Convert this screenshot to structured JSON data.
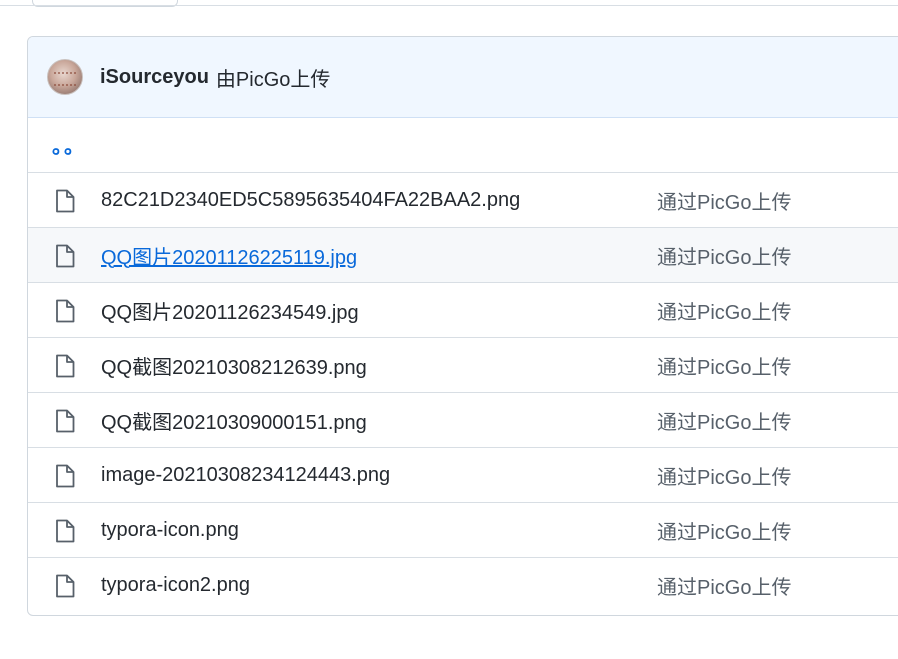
{
  "commit": {
    "author": "iSourceyou",
    "message": "由PicGo上传"
  },
  "parent_link": "。。",
  "files": [
    {
      "name": "82C21D2340ED5C5895635404FA22BAA2.png",
      "message": "通过PicGo上传"
    },
    {
      "name": "QQ图片20201126225119.jpg",
      "message": "通过PicGo上传"
    },
    {
      "name": "QQ图片20201126234549.jpg",
      "message": "通过PicGo上传"
    },
    {
      "name": "QQ截图20210308212639.png",
      "message": "通过PicGo上传"
    },
    {
      "name": "QQ截图20210309000151.png",
      "message": "通过PicGo上传"
    },
    {
      "name": "image-20210308234124443.png",
      "message": "通过PicGo上传"
    },
    {
      "name": "typora-icon.png",
      "message": "通过PicGo上传"
    },
    {
      "name": "typora-icon2.png",
      "message": "通过PicGo上传"
    }
  ],
  "icons": {
    "file": "file-icon",
    "avatar": "avatar"
  },
  "colors": {
    "link": "#0969da",
    "header_bg": "#f0f7ff",
    "hover_row_bg": "#f6f8fa",
    "border": "#d0d7de",
    "muted_text": "#57606a"
  }
}
